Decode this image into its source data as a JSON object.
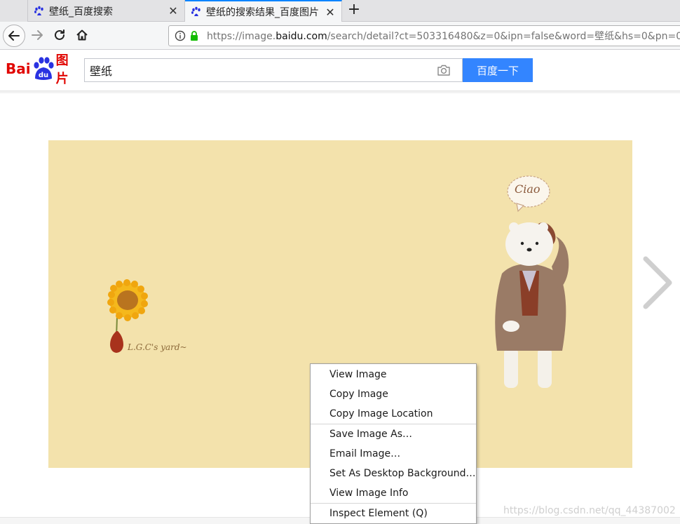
{
  "tabs": [
    {
      "title": "壁纸_百度搜索",
      "close": "✕"
    },
    {
      "title": "壁纸的搜索结果_百度图片",
      "close": "✕"
    }
  ],
  "new_tab": "+",
  "address_bar": {
    "url_prefix": "https://image.",
    "url_host": "baidu.com",
    "url_suffix": "/search/detail?ct=503316480&z=0&ipn=false&word=壁纸&hs=0&pn=0"
  },
  "baidu": {
    "logo_bai": "Bai",
    "logo_du": "du",
    "logo_img": "图片",
    "search_value": "壁纸",
    "search_button": "百度一下"
  },
  "image": {
    "signature": "L.G.C's yard~",
    "speech": "Ciao"
  },
  "context_menu": {
    "items": [
      "View Image",
      "Copy Image",
      "Copy Image Location",
      "Save Image As…",
      "Email Image…",
      "Set As Desktop Background…",
      "View Image Info",
      "Inspect Element (Q)"
    ]
  },
  "watermark": "https://blog.csdn.net/qq_44387002",
  "colors": {
    "accent": "#0a84ff",
    "baidu_red": "#e10602",
    "baidu_blue": "#2932e1",
    "search_button": "#3385ff",
    "image_background": "#f3e2ac"
  }
}
